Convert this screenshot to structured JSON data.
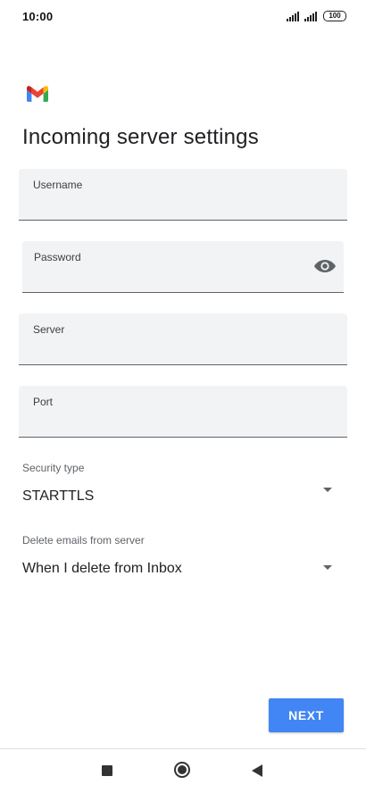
{
  "status_bar": {
    "time": "10:00",
    "battery": "100",
    "icons": [
      "signal-icon",
      "signal-icon",
      "battery-icon"
    ]
  },
  "app": {
    "logo": "gmail-logo",
    "title": "Incoming server settings"
  },
  "fields": {
    "username": {
      "label": "Username",
      "value": ""
    },
    "password": {
      "label": "Password",
      "value": "",
      "icon": "eye-icon"
    },
    "server": {
      "label": "Server",
      "value": ""
    },
    "port": {
      "label": "Port",
      "value": ""
    }
  },
  "security_type": {
    "label": "Security type",
    "selected": "STARTTLS"
  },
  "delete_emails": {
    "label": "Delete emails from server",
    "selected": "When I delete from Inbox"
  },
  "actions": {
    "next_label": "NEXT"
  },
  "colors": {
    "primary": "#4285f4",
    "field_background": "#f1f3f4",
    "text": "#202124"
  },
  "nav_bar": {
    "buttons": [
      "recents-button",
      "home-button",
      "back-button"
    ]
  }
}
